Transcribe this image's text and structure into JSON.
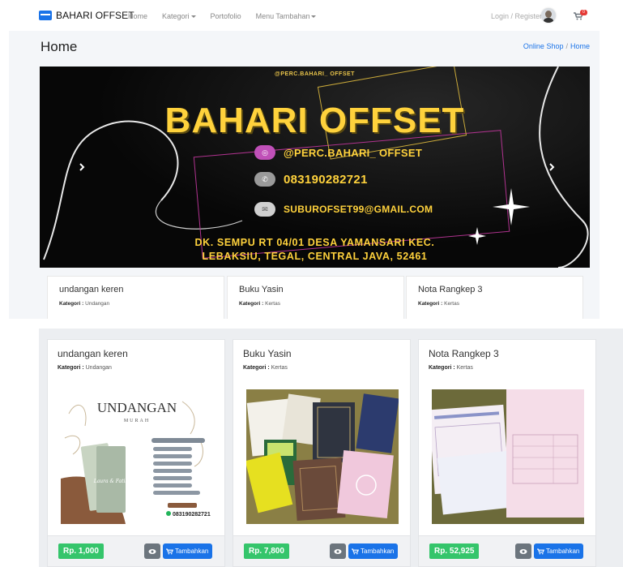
{
  "navbar": {
    "brand": "BAHARI OFFSET",
    "links": [
      "Home",
      "Kategori",
      "Portofolio",
      "Menu Tambahan"
    ],
    "login": "Login / Register",
    "cart_count": "0"
  },
  "header": {
    "title": "Home",
    "breadcrumb": [
      "Online Shop",
      "Home"
    ]
  },
  "banner": {
    "handle_top": "@PERC.BAHARI_ OFFSET",
    "title": "BAHARI OFFSET",
    "instagram": "@PERC.BAHARI_ OFFSET",
    "phone": "083190282721",
    "email": "SUBUROFSET99@GMAIL.COM",
    "address_line1": "DK. SEMPU RT 04/01 DESA YAMANSARI KEC.",
    "address_line2": "LEBAKSIU, TEGAL, CENTRAL JAVA, 52461"
  },
  "preview_cards": [
    {
      "name": "undangan keren",
      "kategori_label": "Kategori :",
      "kategori": "Undangan"
    },
    {
      "name": "Buku Yasin",
      "kategori_label": "Kategori :",
      "kategori": "Kertas"
    },
    {
      "name": "Nota Rangkep 3",
      "kategori_label": "Kategori :",
      "kategori": "Kertas"
    }
  ],
  "products": [
    {
      "name": "undangan keren",
      "kategori_label": "Kategori :",
      "kategori": "Undangan",
      "price": "Rp. 1,000",
      "add_label": "Tambahkan",
      "img_title": "UNDANGAN",
      "img_sub": "MURAH",
      "img_phone": "083190282721",
      "img_name": "Laura & Fatih"
    },
    {
      "name": "Buku Yasin",
      "kategori_label": "Kategori :",
      "kategori": "Kertas",
      "price": "Rp. 7,800",
      "add_label": "Tambahkan"
    },
    {
      "name": "Nota Rangkep 3",
      "kategori_label": "Kategori :",
      "kategori": "Kertas",
      "price": "Rp. 52,925",
      "add_label": "Tambahkan"
    }
  ],
  "colors": {
    "accent": "#1a73e8",
    "price_green": "#35c56b",
    "banner_yellow": "#ffd23c"
  }
}
